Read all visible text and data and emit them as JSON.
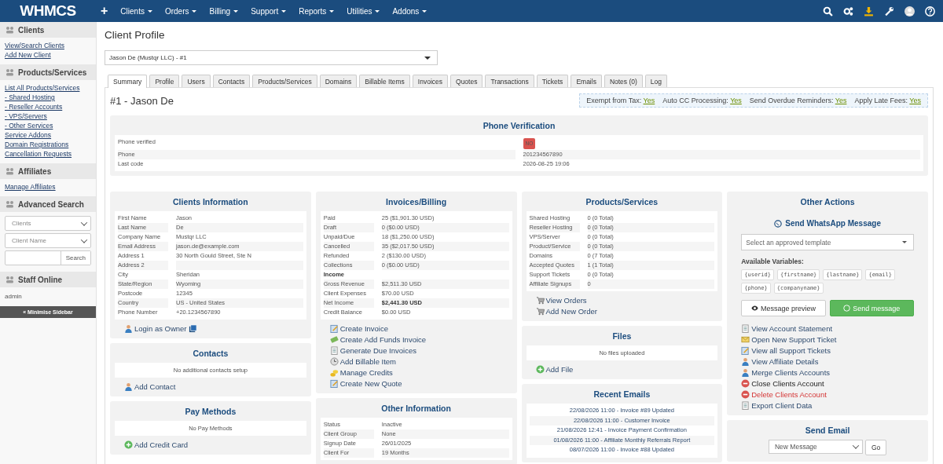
{
  "topbar": {
    "logo": "WHMCS",
    "add_symbol": "+",
    "menu": [
      "Clients",
      "Orders",
      "Billing",
      "Support",
      "Reports",
      "Utilities",
      "Addons"
    ]
  },
  "sidebar": {
    "sections": [
      {
        "title": "Clients",
        "kind": "links",
        "links": [
          "View/Search Clients",
          "Add New Client"
        ]
      },
      {
        "title": "Products/Services",
        "kind": "links",
        "links": [
          "List All Products/Services",
          "- Shared Hosting",
          "- Reseller Accounts",
          "- VPS/Servers",
          "- Other Services",
          "Service Addons",
          "Domain Registrations",
          "Cancellation Requests"
        ]
      },
      {
        "title": "Affiliates",
        "kind": "links",
        "links": [
          "Manage Affiliates"
        ]
      },
      {
        "title": "Advanced Search",
        "kind": "search",
        "selects": [
          "Clients",
          "Client Name"
        ],
        "button": "Search"
      },
      {
        "title": "Staff Online",
        "kind": "text",
        "text": "admin"
      }
    ],
    "minimise": "« Minimise Sidebar"
  },
  "page": {
    "title": "Client Profile",
    "client_select": "Jason De (Mustqr LLC) - #1",
    "tabs": [
      {
        "label": "Summary",
        "selected": true
      },
      {
        "label": "Profile",
        "selected": false
      },
      {
        "label": "Users",
        "selected": false
      },
      {
        "label": "Contacts",
        "selected": false
      },
      {
        "label": "Products/Services",
        "selected": false
      },
      {
        "label": "Domains",
        "selected": false
      },
      {
        "label": "Billable Items",
        "selected": false
      },
      {
        "label": "Invoices",
        "selected": false
      },
      {
        "label": "Quotes",
        "selected": false
      },
      {
        "label": "Transactions",
        "selected": false
      },
      {
        "label": "Tickets",
        "selected": false
      },
      {
        "label": "Emails",
        "selected": false
      },
      {
        "label": "Notes (0)",
        "selected": false
      },
      {
        "label": "Log",
        "selected": false
      }
    ],
    "client_heading": "#1 - Jason De",
    "flags": [
      {
        "label": "Exempt from Tax:",
        "value": "Yes"
      },
      {
        "label": "Auto CC Processing:",
        "value": "Yes"
      },
      {
        "label": "Send Overdue Reminders:",
        "value": "Yes"
      },
      {
        "label": "Apply Late Fees:",
        "value": "Yes"
      }
    ],
    "phone_verification": {
      "title": "Phone Verification",
      "rows": [
        {
          "label": "Phone verified",
          "value": "NO",
          "kind": "badge"
        },
        {
          "label": "Phone",
          "value": "201234567890",
          "kind": "row"
        },
        {
          "label": "Last code",
          "value": "2026-08-25 19:06",
          "kind": "row"
        }
      ]
    },
    "columns": [
      {
        "cards": [
          {
            "title": "Clients Information",
            "rows": [
              {
                "label": "First Name",
                "value": "Jason",
                "kind": "row"
              },
              {
                "label": "Last Name",
                "value": "De",
                "kind": "row"
              },
              {
                "label": "Company Name",
                "value": "Mustqr LLC",
                "kind": "row"
              },
              {
                "label": "Email Address",
                "value": "jason.de@example.com",
                "kind": "row"
              },
              {
                "label": "Address 1",
                "value": "30 North Gould Street, Ste N",
                "kind": "row"
              },
              {
                "label": "Address 2",
                "kind": "row"
              },
              {
                "label": "City",
                "value": "Sheridan",
                "kind": "row"
              },
              {
                "label": "State/Region",
                "value": "Wyoming",
                "kind": "row"
              },
              {
                "label": "Postcode",
                "value": "12345",
                "kind": "row"
              },
              {
                "label": "Country",
                "value": "US - United States",
                "kind": "row"
              },
              {
                "label": "Phone Number",
                "value": "+20.1234567890",
                "kind": "row"
              }
            ],
            "actions": [
              {
                "label": "Login as Owner",
                "kind": "login"
              }
            ]
          },
          {
            "title": "Contacts",
            "empty": "No additional contacts setup",
            "actions": [
              {
                "label": "Add Contact",
                "kind": "user"
              }
            ]
          },
          {
            "title": "Pay Methods",
            "empty": "No Pay Methods",
            "actions": [
              {
                "label": "Add Credit Card",
                "kind": "add"
              }
            ]
          }
        ]
      },
      {
        "cards": [
          {
            "title": "Invoices/Billing",
            "rows": [
              {
                "label": "Paid",
                "value": "25 ($1,901.30 USD)",
                "kind": "row"
              },
              {
                "label": "Draft",
                "value": "0 ($0.00 USD)",
                "kind": "row"
              },
              {
                "label": "Unpaid/Due",
                "value": "18 ($1,250.00 USD)",
                "kind": "row"
              },
              {
                "label": "Cancelled",
                "value": "35 ($2,017.50 USD)",
                "kind": "row"
              },
              {
                "label": "Refunded",
                "value": "2 ($130.00 USD)",
                "kind": "row"
              },
              {
                "label": "Collections",
                "value": "0 ($0.00 USD)",
                "kind": "row"
              },
              {
                "label": "Income",
                "kind": "heading"
              },
              {
                "label": "Gross Revenue",
                "value": "$2,511.30 USD",
                "kind": "row"
              },
              {
                "label": "Client Expenses",
                "value": "$70.00 USD",
                "kind": "row"
              },
              {
                "label": "Net Income",
                "value": "$2,441.30 USD",
                "kind": "total"
              },
              {
                "label": "Credit Balance",
                "value": "$0.00 USD",
                "kind": "row"
              }
            ],
            "actions": [
              {
                "label": "Create Invoice",
                "kind": "edit"
              },
              {
                "label": "Create Add Funds Invoice",
                "kind": "money"
              },
              {
                "label": "Generate Due Invoices",
                "kind": "document"
              },
              {
                "label": "Add Billable Item",
                "kind": "clock"
              },
              {
                "label": "Manage Credits",
                "kind": "coins"
              },
              {
                "label": "Create New Quote",
                "kind": "edit"
              }
            ]
          },
          {
            "title": "Other Information",
            "rows": [
              {
                "label": "Status",
                "value": "Inactive",
                "kind": "row"
              },
              {
                "label": "Client Group",
                "value": "None",
                "kind": "row"
              },
              {
                "label": "Signup Date",
                "value": "26/01/2025",
                "kind": "row"
              },
              {
                "label": "Client For",
                "value": "19 Months",
                "kind": "row"
              }
            ]
          }
        ]
      },
      {
        "cards": [
          {
            "title": "Products/Services",
            "rows": [
              {
                "label": "Shared Hosting",
                "value": "0 (0 Total)",
                "kind": "row"
              },
              {
                "label": "Reseller Hosting",
                "value": "0 (0 Total)",
                "kind": "row"
              },
              {
                "label": "VPS/Server",
                "value": "0 (0 Total)",
                "kind": "row"
              },
              {
                "label": "Product/Service",
                "value": "0 (0 Total)",
                "kind": "row"
              },
              {
                "label": "Domains",
                "value": "0 (7 Total)",
                "kind": "row"
              },
              {
                "label": "Accepted Quotes",
                "value": "1 (1 Total)",
                "kind": "row"
              },
              {
                "label": "Support Tickets",
                "value": "0 (0 Total)",
                "kind": "row"
              },
              {
                "label": "Affiliate Signups",
                "value": "0",
                "kind": "row"
              }
            ],
            "actions": [
              {
                "label": "View Orders",
                "kind": "cart"
              },
              {
                "label": "Add New Order",
                "kind": "cart"
              }
            ]
          },
          {
            "title": "Files",
            "empty": "No files uploaded",
            "actions": [
              {
                "label": "Add File",
                "kind": "add"
              }
            ]
          },
          {
            "title": "Recent Emails",
            "emails": [
              "22/08/2026 11:00 - Invoice #89 Updated",
              "22/08/2026 11:00 - Customer Invoice",
              "21/08/2026 12:41 - Invoice Payment Confirmation",
              "01/08/2026 11:00 - Affiliate Monthly Referrals Report",
              "08/07/2026 11:00 - Invoice #88 Updated"
            ]
          }
        ]
      },
      {
        "cards": [
          {
            "title": "Other Actions",
            "whatsapp": {
              "title": "Send WhatsApp Message",
              "placeholder": "Select an approved template",
              "variables_label": "Available Variables:",
              "variables": [
                "{userid}",
                "{firstname}",
                "{lastname}",
                "{email}",
                "{phone}",
                "{companyname}"
              ],
              "preview_button": "Message preview",
              "send_button": "Send message"
            },
            "actions": [
              {
                "label": "View Account Statement",
                "kind": "document"
              },
              {
                "label": "Open New Support Ticket",
                "kind": "ticket"
              },
              {
                "label": "View all Support Tickets",
                "kind": "edit"
              },
              {
                "label": "View Affiliate Details",
                "kind": "user"
              },
              {
                "label": "Merge Clients Accounts",
                "kind": "user"
              },
              {
                "label": "Close Clients Account",
                "kind": "close"
              },
              {
                "label": "Delete Clients Account",
                "kind": "delete"
              },
              {
                "label": "Export Client Data",
                "kind": "document"
              }
            ]
          },
          {
            "title": "Send Email",
            "email_select": "New Message",
            "go_button": "Go"
          }
        ]
      }
    ]
  }
}
